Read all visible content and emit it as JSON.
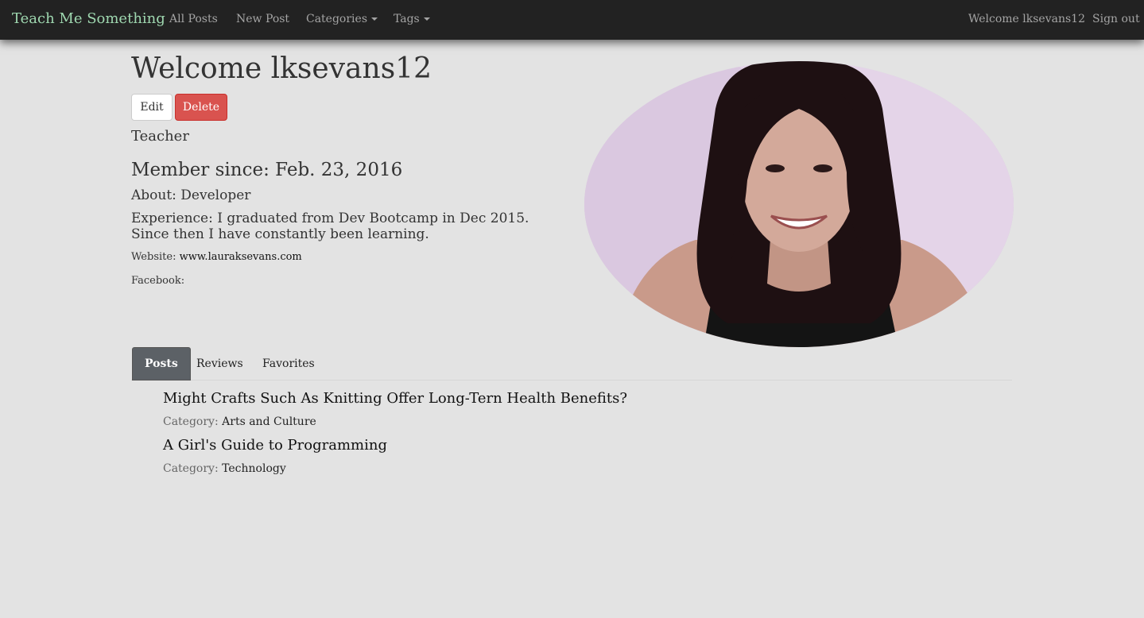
{
  "navbar": {
    "brand": "Teach Me Something",
    "links": {
      "all_posts": "All Posts",
      "new_post": "New Post",
      "categories": "Categories",
      "tags": "Tags"
    },
    "welcome": "Welcome lksevans12",
    "sign_out": "Sign out"
  },
  "profile": {
    "title": "Welcome lksevans12",
    "edit_label": "Edit",
    "delete_label": "Delete",
    "role": "Teacher",
    "member_since": "Member since: Feb. 23, 2016",
    "about": "About: Developer",
    "experience": "Experience: I graduated from Dev Bootcamp in Dec 2015. Since then I have constantly been learning.",
    "website_label": "Website:",
    "website_value": "www.lauraksevans.com",
    "facebook_label": "Facebook:"
  },
  "tabs": {
    "posts": "Posts",
    "reviews": "Reviews",
    "favorites": "Favorites",
    "active": "Posts"
  },
  "posts": [
    {
      "title": "Might Crafts Such As Knitting Offer Long-Tern Health Benefits?",
      "category_label": "Category:",
      "category": "Arts and Culture"
    },
    {
      "title": "A Girl's Guide to Programming",
      "category_label": "Category:",
      "category": "Technology"
    }
  ],
  "colors": {
    "navbar_bg": "#222222",
    "brand": "#9fd8b0",
    "page_bg": "#e3e3e3",
    "delete_button": "#d9534f",
    "active_tab": "#5c6166"
  }
}
